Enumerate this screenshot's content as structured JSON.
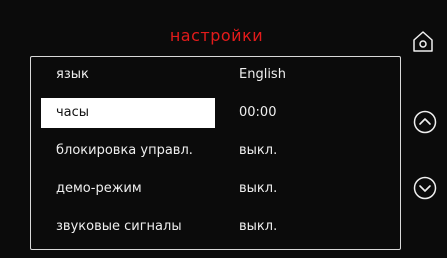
{
  "header": {
    "title": "настройки"
  },
  "settings": {
    "rows": [
      {
        "label": "язык",
        "value": "English"
      },
      {
        "label": "часы",
        "value": "00:00"
      },
      {
        "label": "блокировка управл.",
        "value": "выкл."
      },
      {
        "label": "демо-режим",
        "value": "выкл."
      },
      {
        "label": "звуковые сигналы",
        "value": "выкл."
      }
    ],
    "selected_index": 1
  },
  "controls": {
    "home_icon": "home-icon",
    "up_icon": "chevron-up-circle-icon",
    "down_icon": "chevron-down-circle-icon"
  },
  "colors": {
    "title": "#e31b1b",
    "background": "#0b0b0b",
    "selection": "#ffffff"
  }
}
